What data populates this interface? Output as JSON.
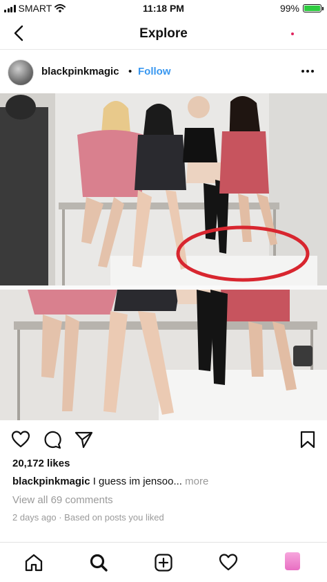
{
  "status_bar": {
    "carrier": "SMART",
    "time": "11:18 PM",
    "battery_percent": "99%",
    "battery_level": 0.99,
    "battery_color": "#2ecc40"
  },
  "header": {
    "title": "Explore",
    "back_icon": "chevron-left-icon"
  },
  "post": {
    "username": "blackpinkmagic",
    "separator": "•",
    "follow_label": "Follow",
    "follow_color": "#3897f0",
    "more_icon": "ellipsis-horizontal-icon",
    "actions": [
      "heart-icon",
      "comment-icon",
      "share-icon",
      "bookmark-icon"
    ],
    "likes": "20,172 likes",
    "caption_user": "blackpinkmagic",
    "caption_text": " I guess im jensoo...",
    "caption_more": " more",
    "view_comments": "View all 69 comments",
    "time_ago": "2 days ago",
    "meta_separator": " · ",
    "source": "Based on posts you liked"
  },
  "tab_bar": {
    "items": [
      "home-icon",
      "search-icon",
      "new-post-icon",
      "activity-heart-icon",
      "profile-avatar"
    ],
    "active_dot_color": "#e0245e"
  }
}
